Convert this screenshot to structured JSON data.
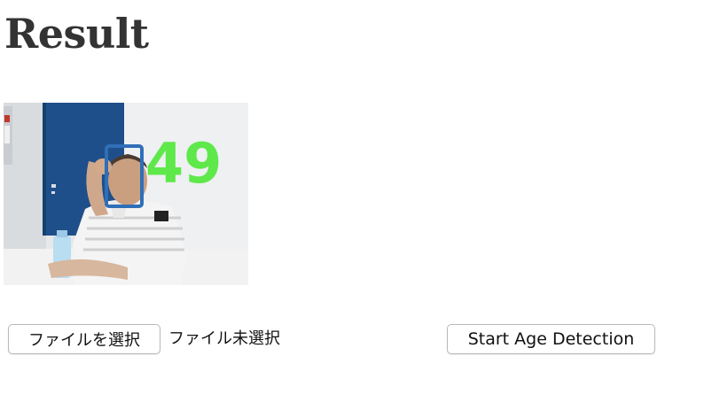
{
  "header": {
    "title": "Result"
  },
  "result": {
    "detected_age": "49",
    "age_label_color": "#5ee84a",
    "face_box_color": "#2f6fb8"
  },
  "upload": {
    "choose_file_label": "ファイルを選択",
    "file_status": "ファイル未選択"
  },
  "actions": {
    "start_label": "Start Age Detection"
  }
}
